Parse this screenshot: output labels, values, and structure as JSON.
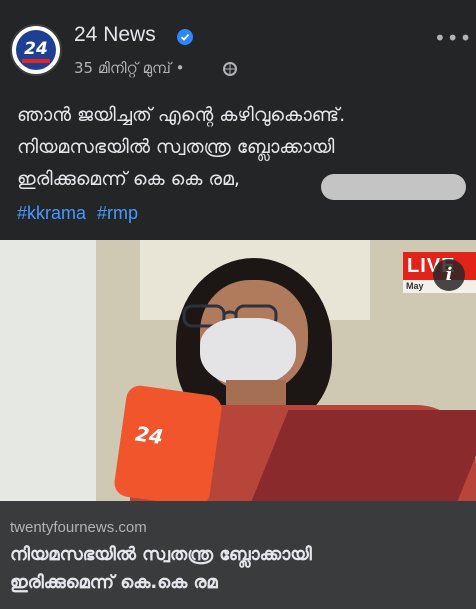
{
  "post": {
    "page_name": "24 News",
    "timestamp": "35 മിനിറ്റ് മുമ്പ്",
    "separator": "•",
    "more_label": "•••",
    "verified_icon": "verified-badge-icon",
    "audience_icon": "globe-icon",
    "avatar_text": "24",
    "caption_lines": [
      "ഞാൻ ജയിച്ചത് എന്റെ കഴിവുകൊണ്ട്.",
      "നിയമസഭയിൽ സ്വതന്ത്ര ബ്ലോക്കായി",
      "ഇരിക്കുമെന്ന് കെ കെ രമ,"
    ],
    "hashtags": [
      "#kkrama",
      "#rmp"
    ]
  },
  "media": {
    "live_label": "LIVE",
    "live_sub": "May",
    "mic_logo": "24",
    "info_label": "i"
  },
  "link_preview": {
    "domain": "twentyfournews.com",
    "title_lines": [
      "നിയമസഭയിൽ സ്വതന്ത്ര ബ്ലോക്കായി",
      "ഇരിക്കുമെന്ന് കെ.കെ രമ"
    ]
  },
  "colors": {
    "background": "#242526",
    "text_primary": "#e4e6eb",
    "text_secondary": "#b0b3b8",
    "link_blue": "#4599ff",
    "verified_blue": "#2d88ff",
    "live_red": "#e2231a"
  }
}
